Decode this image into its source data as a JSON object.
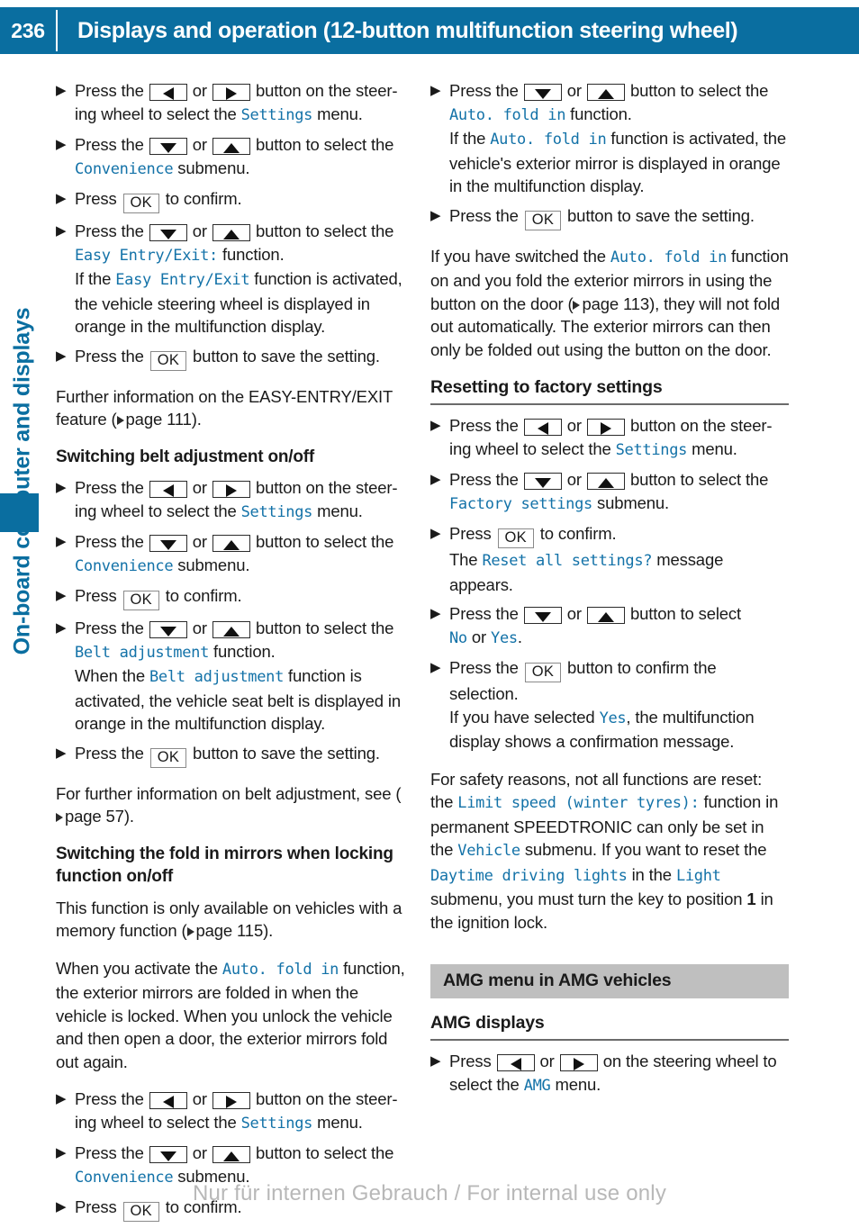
{
  "header": {
    "page_number": "236",
    "title": "Displays and operation (12-button multifunction steering wheel)"
  },
  "sidebar": {
    "chapter_label": "On-board computer and displays"
  },
  "keys": {
    "left": "left-arrow-button",
    "right": "right-arrow-button",
    "up": "up-arrow-button",
    "down": "down-arrow-button",
    "ok": "OK"
  },
  "left_column": {
    "steps_easy_entry": [
      {
        "lead": "Press the",
        "key1": "left",
        "or": "or",
        "key2": "right",
        "tail": "button on the steer-ing wheel to select the",
        "disp": "Settings",
        "tail2": "menu."
      },
      {
        "lead": "Press the",
        "key1": "down",
        "or": "or",
        "key2": "up",
        "tail": "button to select the",
        "disp": "Convenience",
        "tail2": "submenu."
      },
      {
        "lead": "Press",
        "key1": "ok",
        "tail": "to confirm."
      },
      {
        "lead": "Press the",
        "key1": "down",
        "or": "or",
        "key2": "up",
        "tail": "button to select the",
        "disp": "Easy Entry/Exit:",
        "tail2": "function.",
        "note_pre": "If the",
        "note_disp": "Easy Entry/Exit",
        "note_post": "function is activated, the vehicle steering wheel is displayed in orange in the multifunction display."
      },
      {
        "lead": "Press the",
        "key1": "ok",
        "tail": "button to save the setting."
      }
    ],
    "further_info_easy_entry": {
      "text_before": "Further information on the EASY-ENTRY/EXIT feature (",
      "page_ref": "page 111",
      "text_after": ")."
    },
    "heading_belt": "Switching belt adjustment on/off",
    "steps_belt": [
      {
        "lead": "Press the",
        "key1": "left",
        "or": "or",
        "key2": "right",
        "tail": "button on the steer-ing wheel to select the",
        "disp": "Settings",
        "tail2": "menu."
      },
      {
        "lead": "Press the",
        "key1": "down",
        "or": "or",
        "key2": "up",
        "tail": "button to select the",
        "disp": "Convenience",
        "tail2": "submenu."
      },
      {
        "lead": "Press",
        "key1": "ok",
        "tail": "to confirm."
      },
      {
        "lead": "Press the",
        "key1": "down",
        "or": "or",
        "key2": "up",
        "tail": "button to select the",
        "disp": "Belt adjustment",
        "tail2": "function.",
        "note_pre": "When the",
        "note_disp": "Belt adjustment",
        "note_post": "function is activated, the vehicle seat belt is displayed in orange in the multifunction display."
      },
      {
        "lead": "Press the",
        "key1": "ok",
        "tail": "button to save the setting."
      }
    ],
    "further_info_belt": {
      "text_before": "For further information on belt adjustment, see (",
      "page_ref": "page 57",
      "text_after": ")."
    },
    "heading_foldin": "Switching the fold in mirrors when locking function on/off",
    "para_availability": {
      "text_before": "This function is only available on vehicles with a memory function (",
      "page_ref": "page 115",
      "text_after": ")."
    },
    "para_activate": {
      "text_before": "When you activate the",
      "disp": "Auto. fold in",
      "text_after": "function, the exterior mirrors are folded in when the vehicle is locked. When you unlock the vehicle and then open a door, the exterior mirrors fold out again."
    },
    "steps_foldin": [
      {
        "lead": "Press the",
        "key1": "left",
        "or": "or",
        "key2": "right",
        "tail": "button on the steer-ing wheel to select the",
        "disp": "Settings",
        "tail2": "menu."
      },
      {
        "lead": "Press the",
        "key1": "down",
        "or": "or",
        "key2": "up",
        "tail": "button to select the",
        "disp": "Convenience",
        "tail2": "submenu."
      },
      {
        "lead": "Press",
        "key1": "ok",
        "tail": "to confirm."
      }
    ]
  },
  "right_column": {
    "steps_foldin_cont": [
      {
        "lead": "Press the",
        "key1": "down",
        "or": "or",
        "key2": "up",
        "tail": "button to select the",
        "disp": "Auto. fold in",
        "tail2": "function.",
        "note_pre": "If the",
        "note_disp": "Auto. fold in",
        "note_post": "function is activated, the vehicle's exterior mirror is displayed in orange in the multifunction display."
      },
      {
        "lead": "Press the",
        "key1": "ok",
        "tail": "button to save the setting."
      }
    ],
    "para_switched": {
      "text_before": "If you have switched the",
      "disp": "Auto. fold in",
      "text_mid": "function on and you fold the exterior mirrors in using the button on the door (",
      "page_ref": "page 113",
      "text_after": "), they will not fold out automatically. The exterior mirrors can then only be folded out using the button on the door."
    },
    "heading_reset": "Resetting to factory settings",
    "steps_reset": [
      {
        "lead": "Press the",
        "key1": "left",
        "or": "or",
        "key2": "right",
        "tail": "button on the steer-ing wheel to select the",
        "disp": "Settings",
        "tail2": "menu."
      },
      {
        "lead": "Press the",
        "key1": "down",
        "or": "or",
        "key2": "up",
        "tail": "button to select the",
        "disp": "Factory settings",
        "tail2": "submenu."
      },
      {
        "lead": "Press",
        "key1": "ok",
        "tail": "to confirm.",
        "note_pre": "The",
        "note_disp": "Reset all settings?",
        "note_post": "message appears."
      },
      {
        "lead": "Press the",
        "key1": "down",
        "or": "or",
        "key2": "up",
        "tail": "button to select",
        "disp": "No",
        "mid": "or",
        "disp2": "Yes",
        "tail2": "."
      },
      {
        "lead": "Press the",
        "key1": "ok",
        "tail": "button to confirm the selection.",
        "note_pre": "If you have selected",
        "note_disp": "Yes",
        "note_post": ", the multifunction display shows a confirmation message."
      }
    ],
    "para_safety": {
      "p1": "For safety reasons, not all functions are reset: the",
      "disp1": "Limit speed (winter tyres):",
      "p2": "function in permanent SPEEDTRONIC can only be set in the",
      "disp2": "Vehicle",
      "p3": "submenu. If you want to reset the",
      "disp3": "Daytime driving lights",
      "p4": "in the",
      "disp4": "Light",
      "p5": "submenu, you must turn the key to position",
      "bold1": "1",
      "p6": "in the ignition lock."
    },
    "banner_amg": "AMG menu in AMG vehicles",
    "heading_amg_displays": "AMG displays",
    "steps_amg": [
      {
        "lead": "Press",
        "key1": "left",
        "or": "or",
        "key2": "right",
        "tail": "on the steering wheel to select the",
        "disp": "AMG",
        "tail2": "menu."
      }
    ]
  },
  "footer": {
    "watermark": "Nur für internen Gebrauch / For internal use only"
  }
}
